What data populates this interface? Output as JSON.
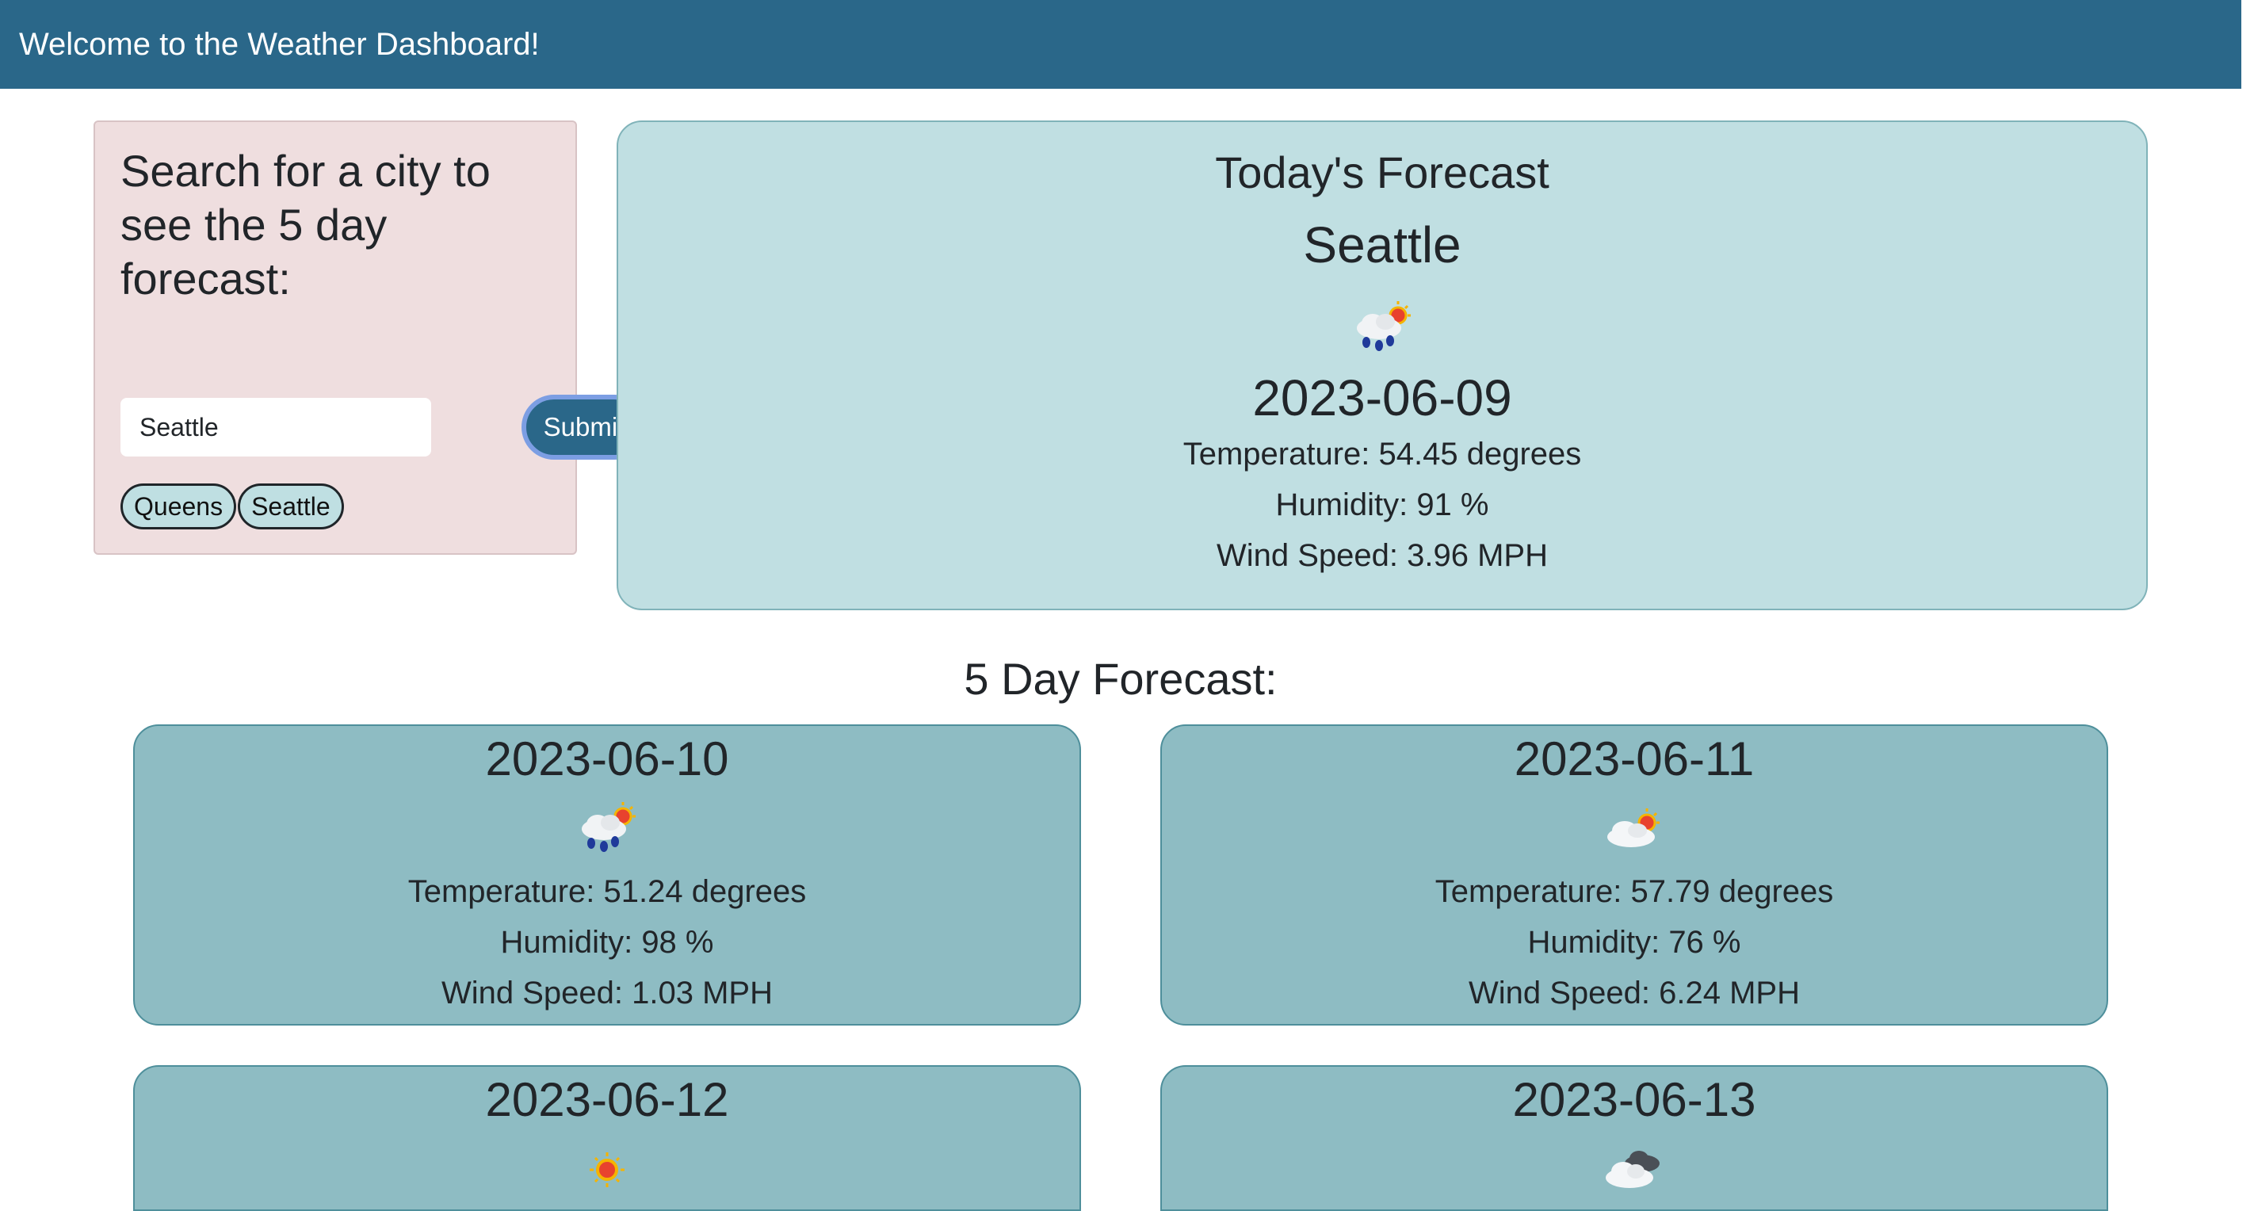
{
  "header": {
    "title": "Welcome to the Weather Dashboard!"
  },
  "search": {
    "heading": "Search for a city to see the 5 day forecast:",
    "input_value": "Seattle",
    "submit_label": "Submit",
    "history": [
      "Queens",
      "Seattle"
    ]
  },
  "today": {
    "heading": "Today's Forecast",
    "city": "Seattle",
    "icon": "rain-sun-icon",
    "date": "2023-06-09",
    "temperature": "Temperature: 54.45 degrees",
    "humidity": "Humidity: 91 %",
    "wind": "Wind Speed: 3.96 MPH"
  },
  "five_day": {
    "heading": "5 Day Forecast:",
    "days": [
      {
        "date": "2023-06-10",
        "icon": "rain-sun-icon",
        "temperature": "Temperature: 51.24 degrees",
        "humidity": "Humidity: 98 %",
        "wind": "Wind Speed: 1.03 MPH"
      },
      {
        "date": "2023-06-11",
        "icon": "cloud-sun-icon",
        "temperature": "Temperature: 57.79 degrees",
        "humidity": "Humidity: 76 %",
        "wind": "Wind Speed: 6.24 MPH"
      },
      {
        "date": "2023-06-12",
        "icon": "sun-icon"
      },
      {
        "date": "2023-06-13",
        "icon": "clouds-icon"
      }
    ]
  }
}
